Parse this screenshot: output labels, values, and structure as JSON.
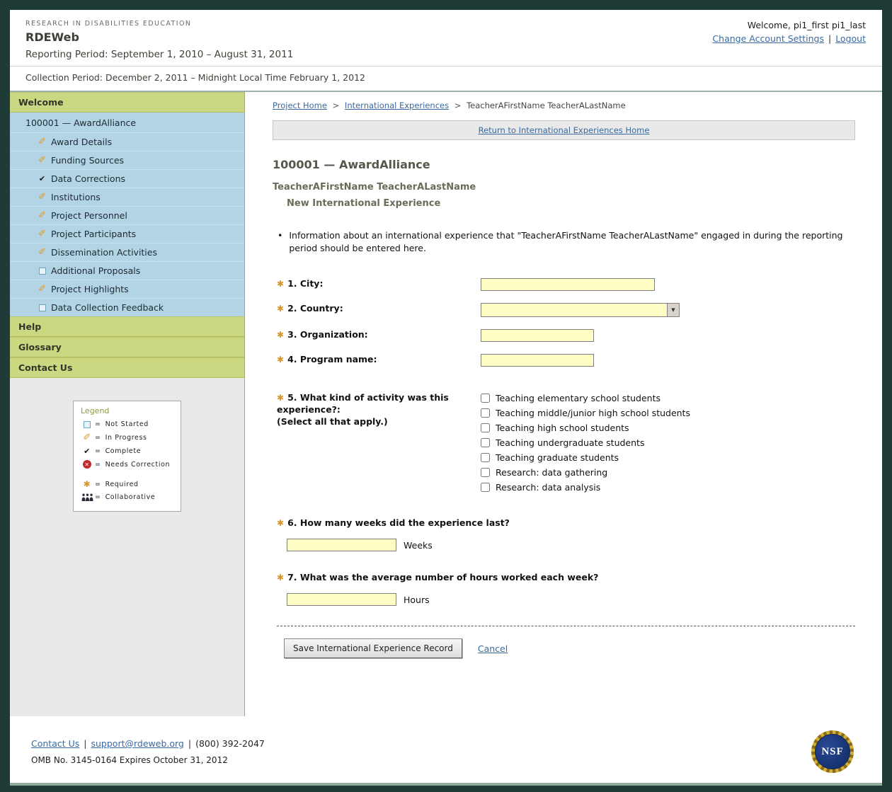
{
  "header": {
    "org_name": "RESEARCH IN DISABILITIES EDUCATION",
    "app_name": "RDEWeb",
    "reporting_period": "Reporting Period: September 1, 2010 – August 31, 2011",
    "collection_period": "Collection Period: December 2, 2011 – Midnight Local Time February 1, 2012",
    "welcome_text": "Welcome, pi1_first pi1_last",
    "change_account_label": "Change Account Settings",
    "logout_label": "Logout"
  },
  "sidebar": {
    "welcome_label": "Welcome",
    "award_label": "100001 — AwardAlliance",
    "items": [
      {
        "icon": "pencil-icon",
        "label": "Award Details"
      },
      {
        "icon": "pencil-icon",
        "label": "Funding Sources"
      },
      {
        "icon": "check-icon",
        "label": "Data Corrections"
      },
      {
        "icon": "pencil-icon",
        "label": "Institutions"
      },
      {
        "icon": "pencil-icon",
        "label": "Project Personnel"
      },
      {
        "icon": "pencil-icon",
        "label": "Project Participants"
      },
      {
        "icon": "pencil-icon",
        "label": "Dissemination Activities"
      },
      {
        "icon": "notstarted-icon",
        "label": "Additional Proposals"
      },
      {
        "icon": "pencil-icon",
        "label": "Project Highlights"
      },
      {
        "icon": "notstarted-icon",
        "label": "Data Collection Feedback"
      }
    ],
    "help_label": "Help",
    "glossary_label": "Glossary",
    "contact_label": "Contact Us"
  },
  "legend": {
    "title": "Legend",
    "entries": [
      {
        "icon": "notstarted-icon",
        "label": "Not Started"
      },
      {
        "icon": "pencil-icon",
        "label": "In Progress"
      },
      {
        "icon": "check-icon",
        "label": "Complete"
      },
      {
        "icon": "error-icon",
        "label": "Needs Correction"
      },
      {
        "icon": "required-icon",
        "label": "Required"
      },
      {
        "icon": "people-icon",
        "label": "Collaborative"
      }
    ]
  },
  "main": {
    "breadcrumb": {
      "home": "Project Home",
      "section": "International Experiences",
      "current": "TeacherAFirstName TeacherALastName"
    },
    "return_link": "Return to International Experiences Home",
    "award_heading": "100001 — AwardAlliance",
    "teacher_heading": "TeacherAFirstName TeacherALastName",
    "subheading": "New International Experience",
    "info_text": "Information about an international experience that \"TeacherAFirstName TeacherALastName\" engaged in during the reporting period should be entered here.",
    "form": {
      "q1_label": "1. City:",
      "q1_value": "",
      "q2_label": "2. Country:",
      "q2_value": "",
      "q3_label": "3. Organization:",
      "q3_value": "",
      "q4_label": "4. Program name:",
      "q4_value": "",
      "q5_label": "5. What kind of activity was this experience?:",
      "q5_hint": "(Select all that apply.)",
      "q5_options": [
        "Teaching elementary school students",
        "Teaching middle/junior high school students",
        "Teaching high school students",
        "Teaching undergraduate students",
        "Teaching graduate students",
        "Research: data gathering",
        "Research: data analysis"
      ],
      "q6_label": "6. How many weeks did the experience last?",
      "q6_value": "",
      "q6_unit": "Weeks",
      "q7_label": "7. What was the average number of hours worked each week?",
      "q7_value": "",
      "q7_unit": "Hours",
      "save_label": "Save International Experience Record",
      "cancel_label": "Cancel"
    }
  },
  "footer": {
    "contact_label": "Contact Us",
    "email": "support@rdeweb.org",
    "phone": "(800) 392-2047",
    "omb_text": "OMB No. 3145-0164 Expires October 31, 2012",
    "nsf_text": "NSF"
  },
  "colors": {
    "frame": "#1e3b38",
    "nav_green": "#ccd881",
    "nav_blue": "#b2d4e5",
    "link_blue": "#3a6aa0",
    "input_yellow": "#ffffc5",
    "required_orange": "#d9952b"
  }
}
